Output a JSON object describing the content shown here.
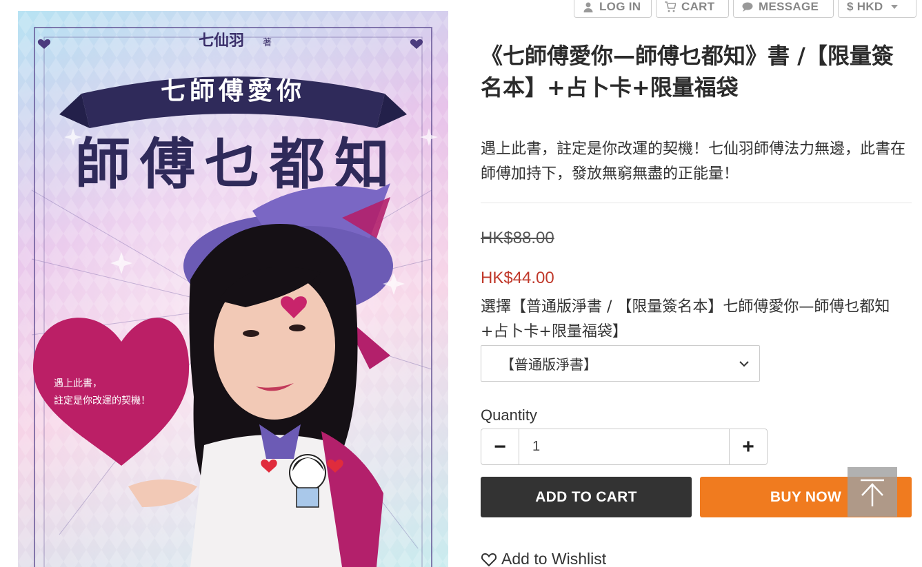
{
  "nav": {
    "login": "LOG IN",
    "cart": "CART",
    "message": "MESSAGE",
    "currency": "$ HKD"
  },
  "cover": {
    "author": "七仙羽",
    "author_suffix": "著",
    "banner_title": "七師傅愛你",
    "main_title": "師傅乜都知",
    "heart_text_line1": "遇上此書，",
    "heart_text_line2": "註定是你改運的契機！"
  },
  "product": {
    "title": "《七師傅愛你—師傅乜都知》書 /【限量簽名本】+占卜卡+限量福袋",
    "description": "遇上此書，註定是你改運的契機！七仙羽師傅法力無邊，此書在師傅加持下，發放無窮無盡的正能量！",
    "original_price": "HK$88.00",
    "sale_price": "HK$44.00",
    "variant_label": "選擇【普通版淨書 / 【限量簽名本】七師傅愛你—師傅乜都知+占卜卡+限量福袋】",
    "variant_selected": "【普通版淨書】",
    "quantity_label": "Quantity",
    "quantity_value": "1",
    "minus": "−",
    "plus": "+",
    "add_to_cart": "ADD TO CART",
    "buy_now": "BUY NOW",
    "wishlist": "Add to Wishlist"
  },
  "colors": {
    "sale_price": "#c0392b",
    "buy_now": "#f07b1f",
    "add_to_cart": "#333333"
  }
}
